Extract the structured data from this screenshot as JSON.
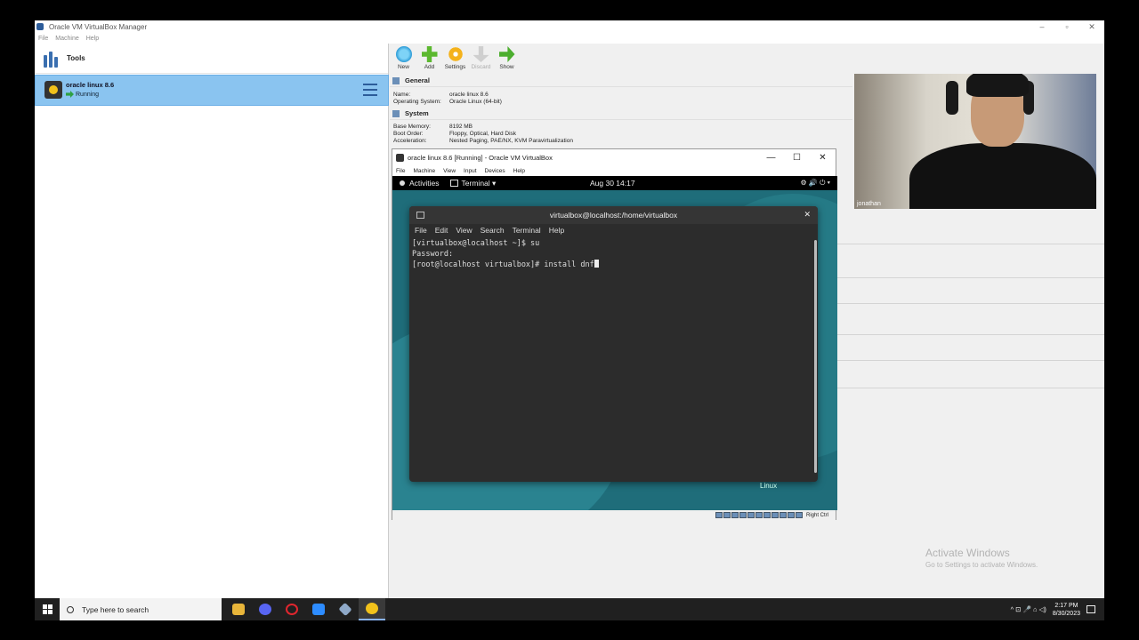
{
  "manager": {
    "title": "Oracle VM VirtualBox Manager",
    "menu": [
      "File",
      "Machine",
      "Help"
    ],
    "window_controls": [
      "–",
      "▫",
      "✕"
    ]
  },
  "left_pane": {
    "tools_label": "Tools",
    "vm": {
      "name": "oracle linux 8.6",
      "state": "Running"
    }
  },
  "toolbar": [
    {
      "label": "New",
      "icon": "new-icon",
      "enabled": true
    },
    {
      "label": "Add",
      "icon": "add-icon",
      "enabled": true
    },
    {
      "label": "Settings",
      "icon": "settings-icon",
      "enabled": true
    },
    {
      "label": "Discard",
      "icon": "discard-icon",
      "enabled": false
    },
    {
      "label": "Show",
      "icon": "show-icon",
      "enabled": true
    }
  ],
  "details": {
    "general": {
      "title": "General",
      "rows": [
        {
          "key": "Name:",
          "value": "oracle linux 8.6"
        },
        {
          "key": "Operating System:",
          "value": "Oracle Linux (64-bit)"
        }
      ]
    },
    "system": {
      "title": "System",
      "rows": [
        {
          "key": "Base Memory:",
          "value": "8192 MB"
        },
        {
          "key": "Boot Order:",
          "value": "Floppy, Optical, Hard Disk"
        },
        {
          "key": "Acceleration:",
          "value": "Nested Paging, PAE/NX, KVM Paravirtualization"
        }
      ]
    }
  },
  "vm_window": {
    "title": "oracle linux 8.6 [Running] - Oracle VM VirtualBox",
    "controls": [
      "—",
      "☐",
      "✕"
    ],
    "menu": [
      "File",
      "Machine",
      "View",
      "Input",
      "Devices",
      "Help"
    ],
    "host_key": "Right Ctrl"
  },
  "guest": {
    "activities": "Activities",
    "app": "Terminal ▾",
    "clock": "Aug 30  14:17",
    "tray": "⚙ 🔊 ⏻ ▾",
    "linux_label": "Linux",
    "terminal": {
      "title": "virtualbox@localhost:/home/virtualbox",
      "close": "✕",
      "menu": [
        "File",
        "Edit",
        "View",
        "Search",
        "Terminal",
        "Help"
      ],
      "lines": [
        "[virtualbox@localhost ~]$ su",
        "Password:",
        "[root@localhost virtualbox]# install dnf"
      ]
    }
  },
  "webcam": {
    "name": "jonathan"
  },
  "watermark": {
    "title": "Activate Windows",
    "subtitle": "Go to Settings to activate Windows."
  },
  "taskbar": {
    "search_placeholder": "Type here to search",
    "time": "2:17 PM",
    "date": "8/30/2023",
    "tray": "^  ⊡  🎤  ⌂  ◁)"
  },
  "colors": {
    "selection": "#8ac4f0",
    "guest_bg": "#1f6d7a",
    "terminal_bg": "#2c2c2c",
    "taskbar": "#202020"
  }
}
